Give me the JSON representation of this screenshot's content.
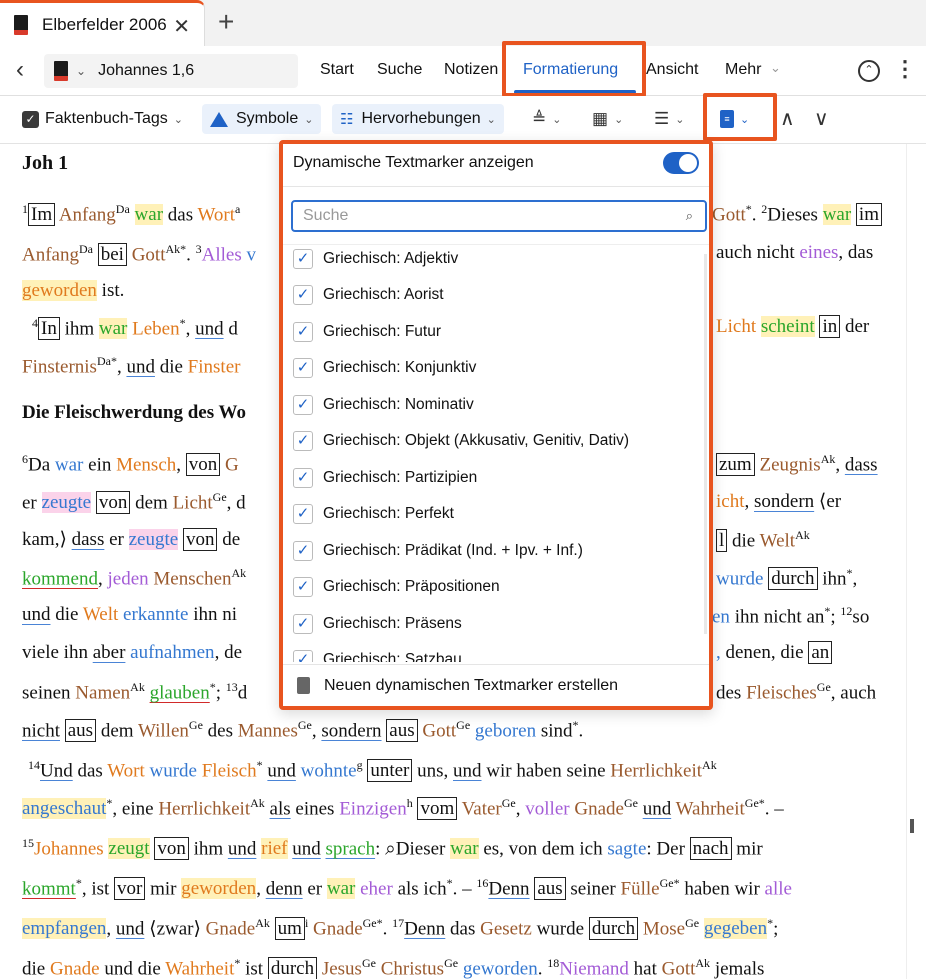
{
  "tab": {
    "title": "Elberfelder 2006",
    "close": "✕",
    "add": "+"
  },
  "nav": {
    "back": "‹",
    "reference": "Johannes 1,6",
    "menu": [
      "Start",
      "Suche",
      "Notizen",
      "Formatierung",
      "Ansicht",
      "Mehr"
    ],
    "active": "Formatierung",
    "more_chev": "⌄",
    "collapse": "⌃",
    "kebab": "⋮"
  },
  "toolbar": {
    "faktenbuch": "Faktenbuch-Tags",
    "symbole": "Symbole",
    "hervorhebungen": "Hervorhebungen",
    "up": "∧",
    "down": "∨"
  },
  "dropdown": {
    "header": "Dynamische Textmarker anzeigen",
    "toggle_on": true,
    "search_placeholder": "Suche",
    "items": [
      "Griechisch: Adjektiv",
      "Griechisch: Aorist",
      "Griechisch: Futur",
      "Griechisch: Konjunktiv",
      "Griechisch: Nominativ",
      "Griechisch: Objekt (Akkusativ, Genitiv, Dativ)",
      "Griechisch: Partizipien",
      "Griechisch: Perfekt",
      "Griechisch: Prädikat (Ind. + Ipv. + Inf.)",
      "Griechisch: Präpositionen",
      "Griechisch: Präsens",
      "Griechisch: Satzbau"
    ],
    "footer": "Neuen dynamischen Textmarker erstellen"
  },
  "text": {
    "chapter": "Joh 1",
    "section": "Die Fleischwerdung des Wo"
  },
  "colors": {
    "accent": "#1f62c6",
    "highlight_box": "#e8541f"
  }
}
